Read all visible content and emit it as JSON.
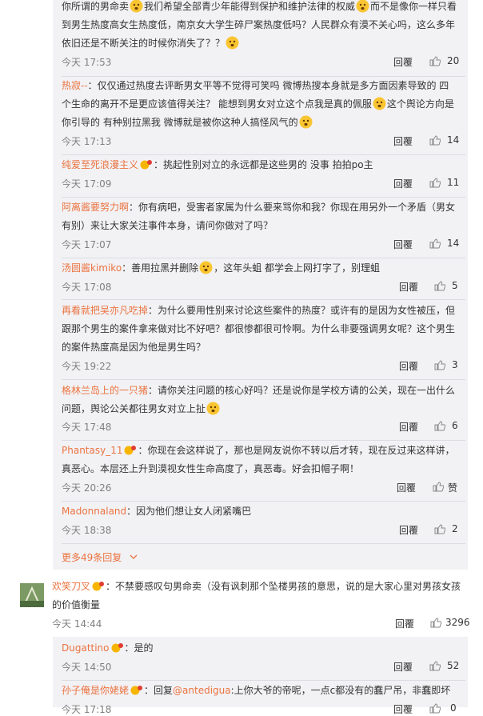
{
  "comments": [
    {
      "lines": [
        "你所谓的男命卖[emoji]我们希望全部青少年能得到保护和维护法律的权威[emoji]而不是像你一样只看",
        "到男生热度高女生热度低，南京女大学生碎尸案热度低吗？人民群众有漠不关心吗，这么多年",
        "依旧还是不断关注的时候你消失了？？[emoji]"
      ],
      "time": "今天 17:53",
      "reply": "回覆",
      "likes": "20"
    },
    {
      "user": "热寂--",
      "text": "：仅仅通过热度去评断男女平等不觉得可笑吗 微博热搜本身就是多方面因素导致的 四",
      "lines": [
        "个生命的离开不是更应该值得关注？ 能想到男女对立这个点我是真的佩服[emoji]这个舆论方向是",
        "你引导的 有种别拉黑我 微博就是被你这种人搞怪风气的[emoji]"
      ],
      "time": "今天 17:13",
      "reply": "回覆",
      "likes": "14"
    },
    {
      "user": "纯爱至死浪漫主义",
      "text": "：挑起性别对立的永远都是这些男的 没事 拍拍po主",
      "time": "今天 17:09",
      "reply": "回覆",
      "likes": "11"
    },
    {
      "user": "阿离酱要努力啊",
      "text": "：你有病吧，受害者家属为什么要来骂你和我？你现在用另外一个矛盾（男女",
      "lines": [
        "有别）来让大家关注事件本身，请问你做对了吗？"
      ],
      "time": "今天 17:07",
      "reply": "回覆",
      "likes": "14"
    },
    {
      "user": "汤圆酱kimiko",
      "text": "：善用拉黑并删除[emoji]，这年头蛆 都学会上网打字了，别理蛆",
      "time": "今天 17:08",
      "reply": "回覆",
      "likes": "5"
    },
    {
      "user": "再看就把吴亦凡吃掉",
      "text": "：为什么要用性别来讨论这些案件的热度？或许有的是因为女性被压，但",
      "lines": [
        "跟那个男生的案件拿来做对比不好吧？都很惨都很可怜啊。为什么非要强调男女呢？这个男生",
        "的案件热度高是因为他是男生吗？"
      ],
      "time": "今天 19:22",
      "reply": "回覆",
      "likes": "3"
    },
    {
      "user": "格林兰岛上的一只猪",
      "text": "：请你关注问题的核心好吗？还是说你是学校方请的公关，现在一出什么",
      "lines": [
        "问题，舆论公关都往男女对立上扯[emoji]"
      ],
      "time": "今天 17:48",
      "reply": "回覆",
      "likes": "6"
    },
    {
      "user": "Phantasy_11",
      "text": "：你现在会这样说了，那也是网友说你不转以后才转，现在反过来这样讲，",
      "lines": [
        "真恶心。本层还上升到漠视女性生命高度了，真恶毒。好会扣帽子啊！"
      ],
      "time": "今天 20:26",
      "reply": "回覆",
      "likes": "赞"
    },
    {
      "user": "Madonnaland",
      "text": "：因为他们想让女人闭紧嘴巴",
      "time": "今天 18:38",
      "reply": "回覆",
      "likes": "2"
    }
  ],
  "more_replies": "更多49条回复",
  "top_comment": {
    "user": "欢笑刀叉",
    "text": "：不禁要感叹句男命卖（没有讽刺那个坠楼男孩的意思，说的是大家心里对男孩女孩",
    "line2": "的价值衡量",
    "time": "今天 14:44",
    "reply": "回覆",
    "likes": "3296"
  },
  "sub_comments": [
    {
      "user": "Dugattino",
      "text": "：是的",
      "time": "今天 14:50",
      "reply": "回覆",
      "likes": "52"
    },
    {
      "user": "孙子俺是你姥姥",
      "text": "：回复",
      "mention": "@antedigua",
      "text2": ":上你大爷的帝呢，一点c都没有的蠢尸吊，非蠢即坏",
      "time": "今天 17:18",
      "reply": "回覆",
      "likes": "0"
    }
  ],
  "colors": {
    "username": "#eb7340",
    "panel": "#f2f2f5",
    "time": "#808080"
  },
  "icons": [
    "emoji-icon",
    "vip-badge-icon",
    "thumb-up-icon",
    "chevron-down-icon",
    "avatar"
  ]
}
